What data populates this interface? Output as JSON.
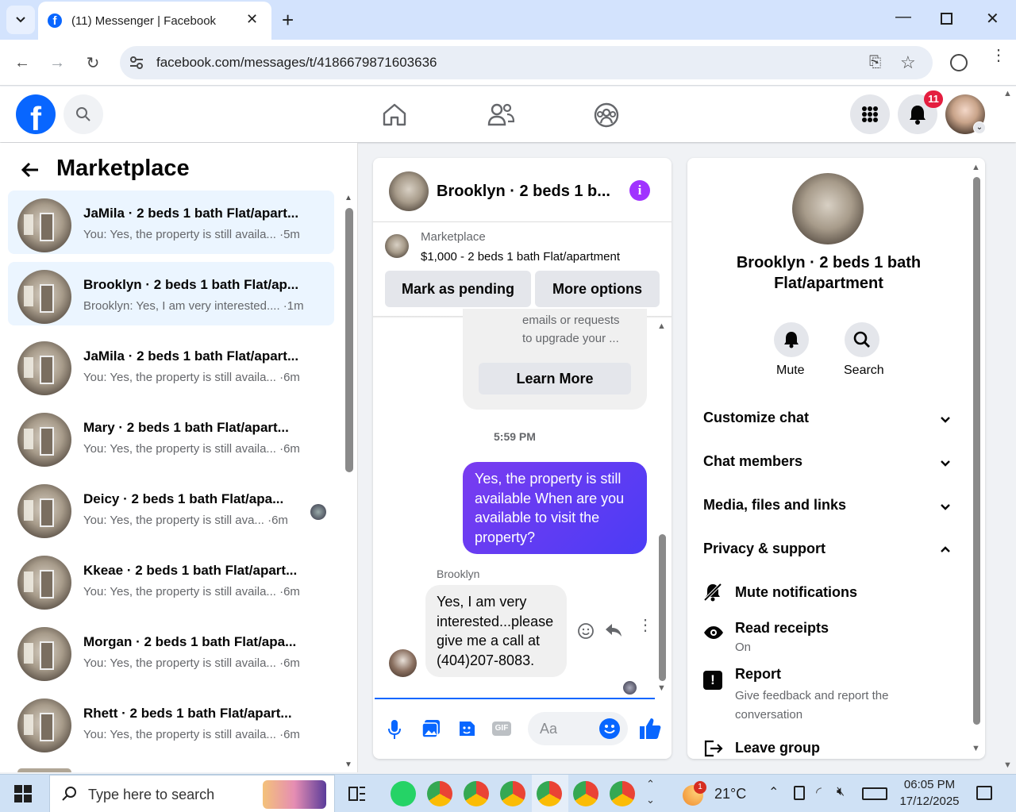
{
  "browser": {
    "tab_title": "(11) Messenger | Facebook",
    "url": "facebook.com/messages/t/4186679871603636"
  },
  "fb": {
    "notification_count": "11"
  },
  "left": {
    "title": "Marketplace",
    "rows": [
      {
        "title": "JaMila · 2 beds 1 bath Flat/apart...",
        "sub": "You: Yes, the property is still availa... ·5m"
      },
      {
        "title": "Brooklyn · 2 beds 1 bath Flat/ap...",
        "sub": "Brooklyn: Yes, I am very interested.... ·1m"
      },
      {
        "title": "JaMila · 2 beds 1 bath Flat/apart...",
        "sub": "You: Yes, the property is still availa... ·6m"
      },
      {
        "title": "Mary · 2 beds 1 bath Flat/apart...",
        "sub": "You: Yes, the property is still availa... ·6m"
      },
      {
        "title": "Deicy · 2 beds 1 bath Flat/apa...",
        "sub": "You: Yes, the property is still ava... ·6m"
      },
      {
        "title": "Kkeae · 2 beds 1 bath Flat/apart...",
        "sub": "You: Yes, the property is still availa... ·6m"
      },
      {
        "title": "Morgan · 2 beds 1 bath Flat/apa...",
        "sub": "You: Yes, the property is still availa... ·6m"
      },
      {
        "title": "Rhett · 2 beds 1 bath Flat/apart...",
        "sub": "You: Yes, the property is still availa... ·6m"
      }
    ]
  },
  "chat": {
    "title": "Brooklyn · 2 beds 1 b...",
    "listing_label": "Marketplace",
    "listing_price": "$1,000 - 2 beds 1 bath Flat/apartment",
    "mark_pending": "Mark as pending",
    "more_options": "More options",
    "card_text_1": "emails or requests",
    "card_text_2": "to upgrade your ...",
    "learn_more": "Learn More",
    "timestamp": "5:59 PM",
    "out_message": "Yes, the property is still available When are you available to visit the property?",
    "sender_name": "Brooklyn",
    "in_message": "Yes, I am very interested...please give me a call at (404)207-8083.",
    "input_placeholder": "Aa"
  },
  "info": {
    "title": "Brooklyn · 2 beds 1 bath Flat/apartment",
    "mute": "Mute",
    "search": "Search",
    "customize": "Customize chat",
    "members": "Chat members",
    "media": "Media, files and links",
    "privacy": "Privacy & support",
    "mute_notifications": "Mute notifications",
    "read_receipts": "Read receipts",
    "read_receipts_state": "On",
    "report": "Report",
    "report_sub": "Give feedback and report the conversation",
    "leave": "Leave group"
  },
  "taskbar": {
    "search_placeholder": "Type here to search",
    "weather": "21°C",
    "weather_badge": "1",
    "time": "06:05 PM",
    "date": "17/12/2025"
  },
  "colors": {
    "fb_blue": "#0866ff",
    "accent_purple": "#a033ff",
    "badge_red": "#e41e3f"
  }
}
